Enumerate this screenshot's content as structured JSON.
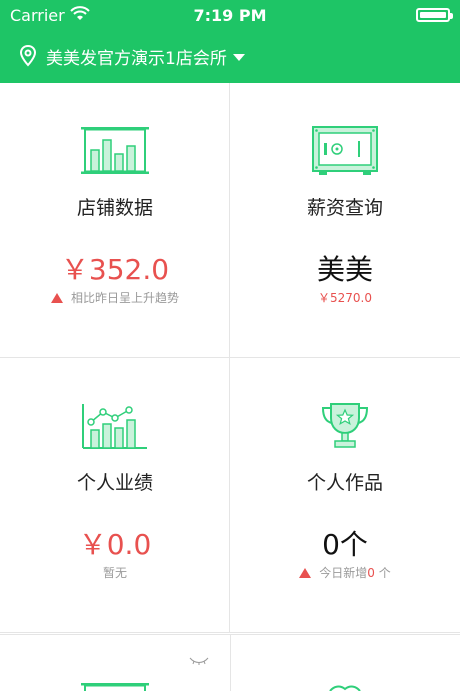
{
  "status_bar": {
    "carrier": "Carrier",
    "time": "7:19 PM"
  },
  "header": {
    "location": "美美发官方演示1店会所"
  },
  "cards": [
    {
      "title": "店铺数据",
      "value": "￥352.0",
      "sub": "相比昨日呈上升趋势",
      "icon": "bar-chart-board-icon"
    },
    {
      "title": "薪资查询",
      "value": "美美",
      "sub": "￥5270.0",
      "icon": "safe-icon"
    },
    {
      "title": "个人业绩",
      "value": "￥0.0",
      "sub": "暂无",
      "icon": "line-bar-chart-icon"
    },
    {
      "title": "个人作品",
      "value": "0个",
      "sub_prefix": "今日新增 ",
      "sub_count": "0",
      "sub_suffix": " 个",
      "icon": "trophy-icon"
    }
  ],
  "colors": {
    "brand_green": "#1ec566",
    "red": "#e8514f",
    "icon_green": "#2fcf7a"
  }
}
